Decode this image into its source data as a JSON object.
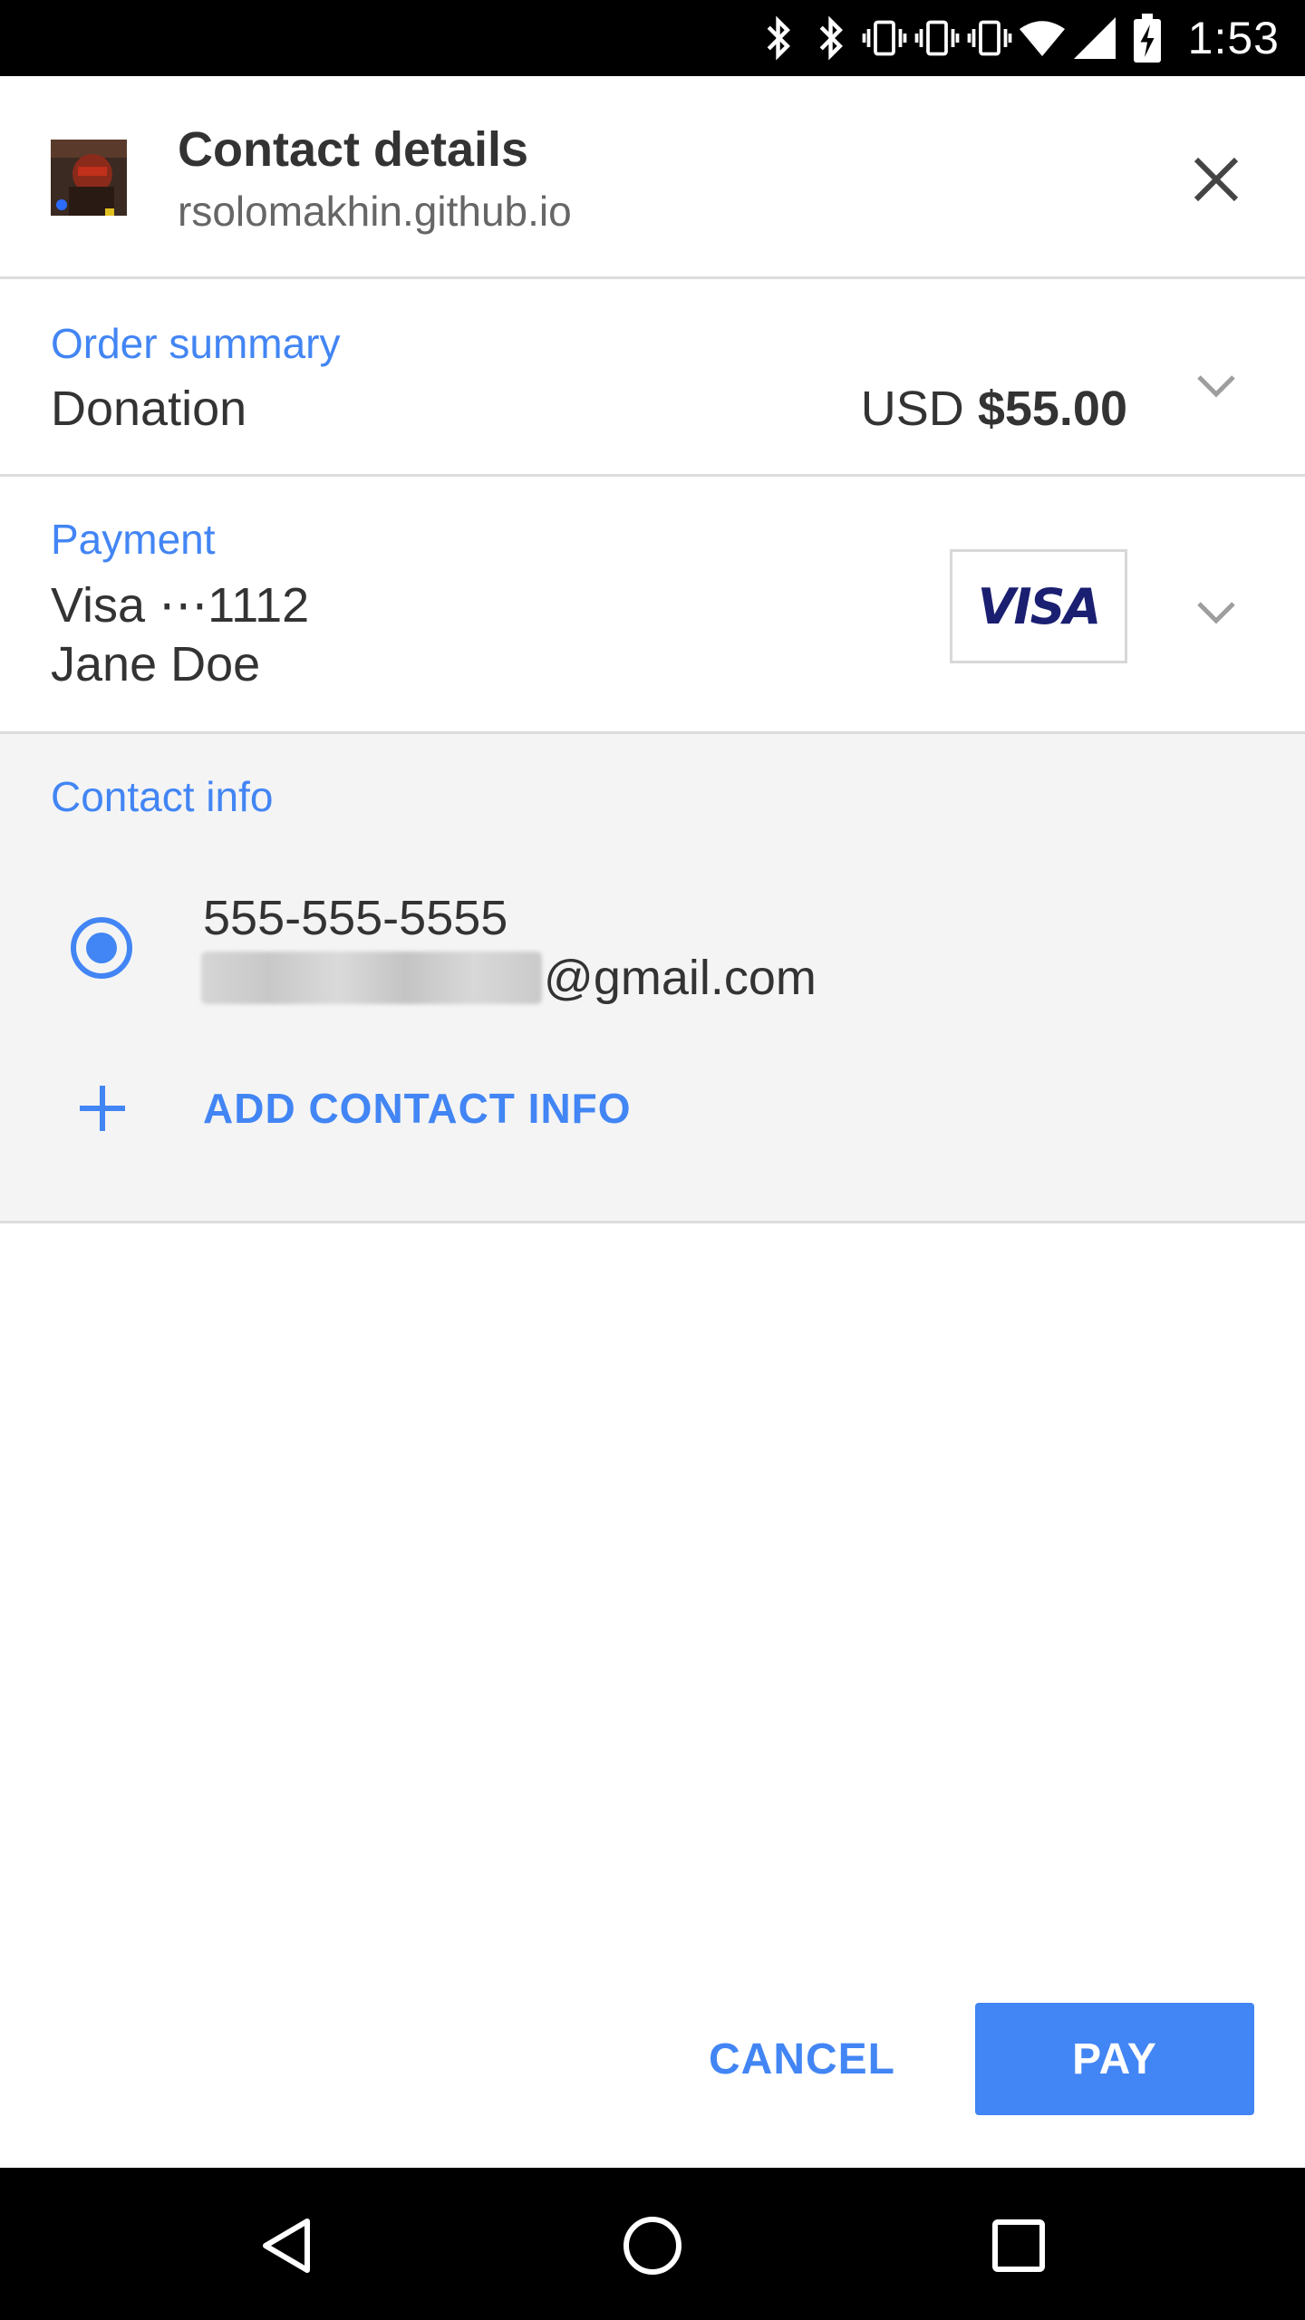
{
  "status_bar": {
    "time": "1:53",
    "icons": [
      "bluetooth-icon",
      "bluetooth-icon",
      "vibrate-icon",
      "vibrate-icon",
      "vibrate-icon",
      "wifi-icon",
      "cell-signal-icon",
      "battery-charging-icon"
    ]
  },
  "header": {
    "title": "Contact details",
    "origin": "rsolomakhin.github.io",
    "close_icon": "close-icon"
  },
  "order_summary": {
    "label": "Order summary",
    "item": "Donation",
    "currency": "USD",
    "amount": "$55.00"
  },
  "payment": {
    "label": "Payment",
    "card": "Visa ⋯1112",
    "name": "Jane Doe",
    "card_brand": "VISA"
  },
  "contact_info": {
    "label": "Contact info",
    "phone": "555-555-5555",
    "email_suffix": "@gmail.com",
    "add_label": "ADD CONTACT INFO"
  },
  "actions": {
    "cancel": "CANCEL",
    "pay": "PAY"
  },
  "colors": {
    "accent": "#4285f4",
    "divider": "#dcdcdc",
    "contact_bg": "#f4f4f4"
  }
}
